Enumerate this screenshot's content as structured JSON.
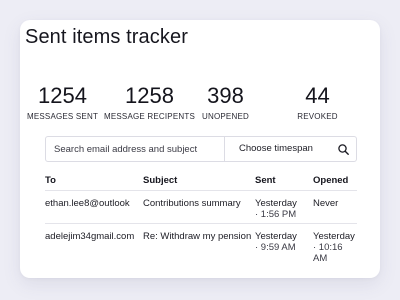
{
  "title": "Sent items tracker",
  "stats": [
    {
      "value": "1254",
      "label": "MESSAGES SENT"
    },
    {
      "value": "1258",
      "label": "MESSAGE RECIPENTS"
    },
    {
      "value": "398",
      "label": "UNOPENED"
    },
    {
      "value": "44",
      "label": "REVOKED"
    }
  ],
  "search": {
    "placeholder": "Search email address and subject",
    "value": "",
    "timespan_label": "Choose timespan",
    "search_icon": "search-icon"
  },
  "table": {
    "columns": [
      "To",
      "Subject",
      "Sent",
      "Opened"
    ],
    "rows": [
      {
        "to": "ethan.lee8@outlook",
        "subject": "Contributions summary",
        "sent_day": "Yesterday",
        "sent_time": "· 1:56 PM",
        "opened_day": "Never",
        "opened_time": ""
      },
      {
        "to": "adelejim34gmail.com",
        "subject": "Re: Withdraw my pension",
        "sent_day": "Yesterday",
        "sent_time": "· 9:59 AM",
        "opened_day": "Yesterday",
        "opened_time": "· 10:16 AM"
      }
    ]
  }
}
